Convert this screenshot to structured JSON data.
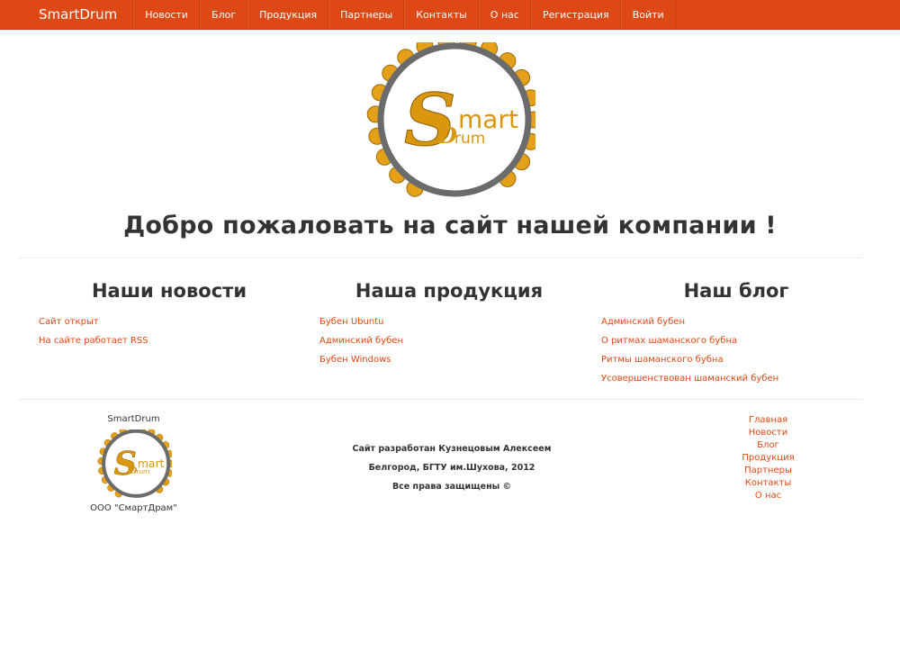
{
  "navbar": {
    "brand": "SmartDrum",
    "items": [
      "Новости",
      "Блог",
      "Продукция",
      "Партнеры",
      "Контакты",
      "О нас",
      "Регистрация",
      "Войти"
    ]
  },
  "logo": {
    "word_top": "mart",
    "word_bottom": "rum",
    "letter_s": "S",
    "letter_d": "D"
  },
  "hero": {
    "title": "Добро пожаловать на сайт нашей компании !"
  },
  "news": {
    "heading": "Наши новости",
    "items": [
      "Сайт открыт",
      "На сайте работает RSS"
    ]
  },
  "products": {
    "heading": "Наша продукция",
    "items": [
      "Бубен Ubuntu",
      "Админский бубен",
      "Бубен Windows"
    ]
  },
  "blog": {
    "heading": "Наш блог",
    "items": [
      "Админский бубен",
      "О ритмах шаманского бубна",
      "Ритмы шаманского бубна",
      "Усовершенствован шаманский бубен"
    ]
  },
  "footer": {
    "company_name": "SmartDrum",
    "legal_name": "ООО \"СмартДрам\"",
    "credits": [
      "Сайт разработан Кузнецовым Алексеем",
      "Белгород, БГТУ им.Шухова, 2012",
      "Все права защищены ©"
    ],
    "links": [
      "Главная",
      "Новости",
      "Блог",
      "Продукция",
      "Партнеры",
      "Контакты",
      "О нас"
    ]
  },
  "colors": {
    "accent": "#dd4814",
    "logo_gold": "#e3a018",
    "logo_ring": "#6b6b6b"
  }
}
